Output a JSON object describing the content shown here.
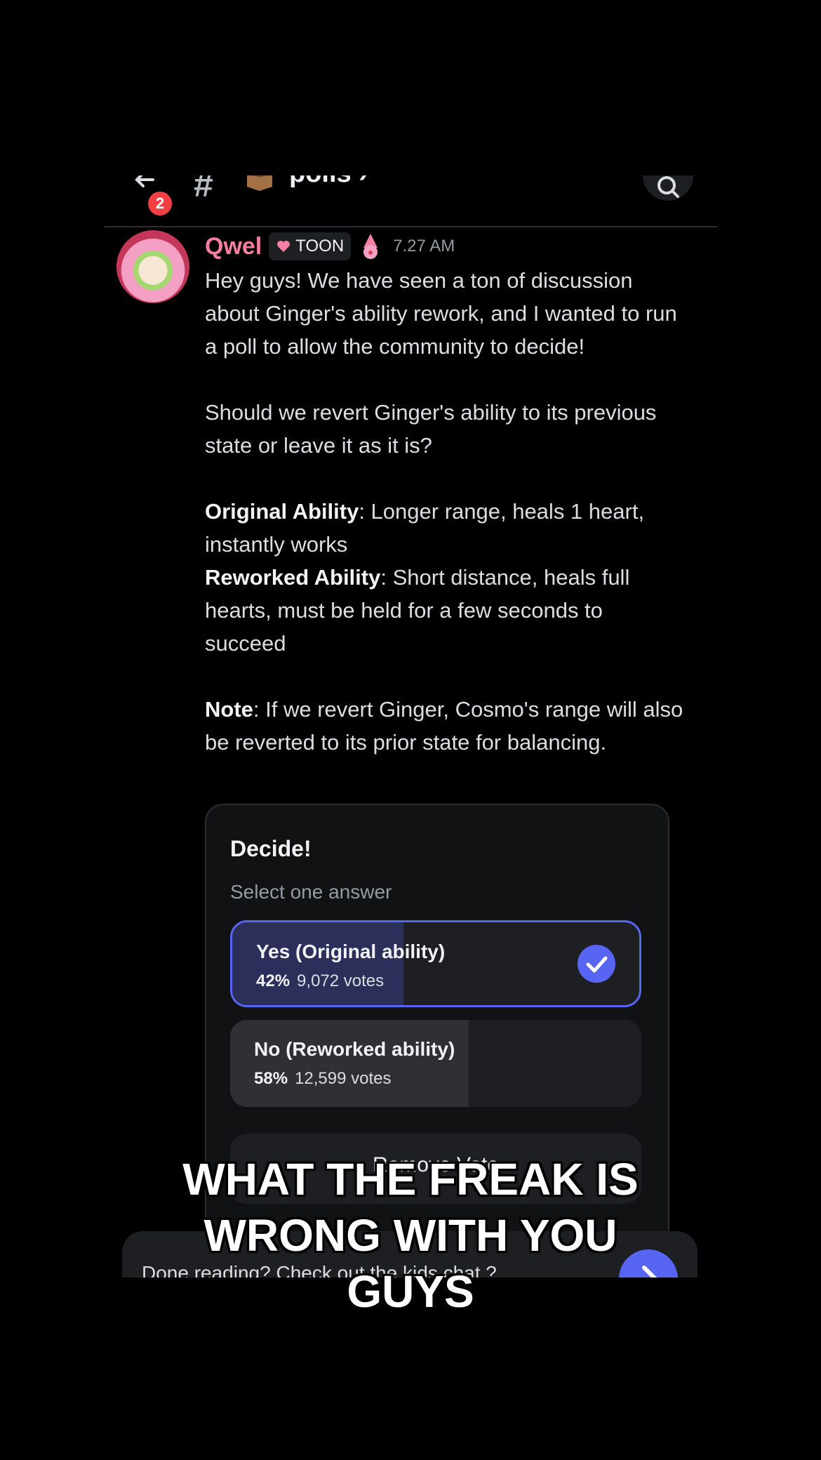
{
  "header": {
    "unread_count": "2",
    "channel_hash": "#",
    "channel_name": "polls ›"
  },
  "message": {
    "username": "Qwel",
    "role_tag": "TOON",
    "timestamp": "7.27 AM",
    "username_color": "#f47fa4",
    "intro": "Hey guys! We have seen a ton of discussion about Ginger's ability rework, and I wanted to run a poll to allow the community to decide!",
    "question": "Should we revert Ginger's ability to its previous state or leave it as it is?",
    "original_label": "Original Ability",
    "original_text": ": Longer range, heals 1 heart, instantly works",
    "reworked_label": "Reworked Ability",
    "reworked_text": ": Short distance, heals full hearts, must be held for a few seconds to succeed",
    "note_label": "Note",
    "note_text": ": If we revert Ginger, Cosmo's range will also be reverted to its prior state for balancing."
  },
  "poll": {
    "title": "Decide!",
    "subtitle": "Select one answer",
    "options": [
      {
        "label": "Yes  (Original ability)",
        "percent": "42%",
        "votes": "9,072 votes",
        "fraction": 0.42,
        "selected": true
      },
      {
        "label": "No (Reworked ability)",
        "percent": "58%",
        "votes": "12,599 votes",
        "fraction": 0.58,
        "selected": false
      }
    ],
    "remove_vote": "Remove Vote",
    "accent_color": "#5865f2"
  },
  "bottom_bar": {
    "text": "Done reading? Check out the kids chat ?"
  },
  "caption": {
    "line1": "WHAT THE FREAK IS",
    "line2": "WRONG WITH YOU",
    "line3": "GUYS"
  }
}
